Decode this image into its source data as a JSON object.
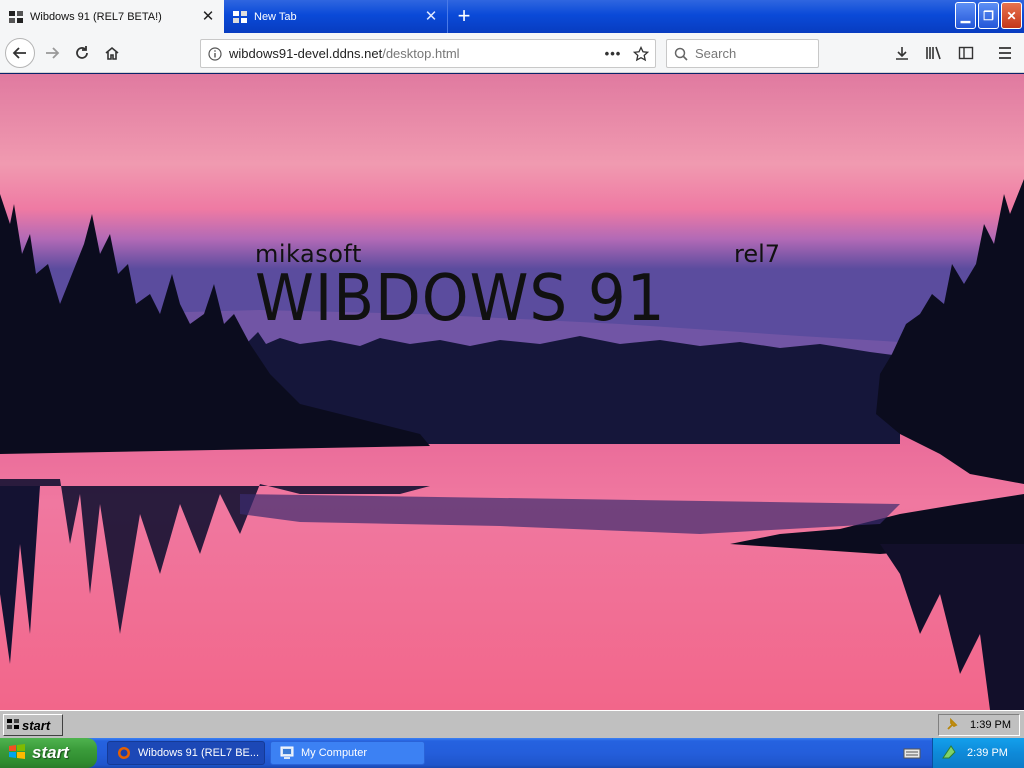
{
  "browser": {
    "tabs": [
      {
        "title": "Wibdows 91 (REL7 BETA!)",
        "active": true
      },
      {
        "title": "New Tab",
        "active": false
      }
    ],
    "url": {
      "host": "wibdows91-devel.ddns.net",
      "path": "/desktop.html"
    },
    "search_placeholder": "Search"
  },
  "page": {
    "brand_company": "mikasoft",
    "brand_product": "WIBDOWS 91",
    "brand_release": "rel7"
  },
  "w91_taskbar": {
    "start_label": "start",
    "clock": "1:39 PM"
  },
  "xp_taskbar": {
    "start_label": "start",
    "tasks": [
      {
        "label": "Wibdows 91 (REL7 BE..."
      },
      {
        "label": "My Computer"
      }
    ],
    "clock": "2:39 PM"
  },
  "colors": {
    "xp_blue": "#245edb",
    "xp_green": "#3a9b3a",
    "sky_pink": "#f07fa0",
    "silhouette": "#0b0c1e"
  }
}
